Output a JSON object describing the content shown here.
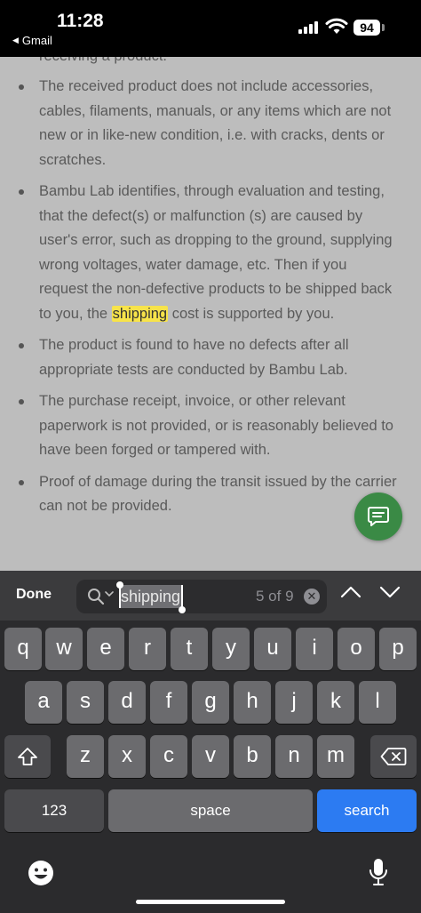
{
  "status_bar": {
    "time": "11:28",
    "back_app": "Gmail",
    "battery": "94"
  },
  "document": {
    "cut_line": "receiving a product.",
    "bullets": [
      {
        "before": "The received product does not include accessories, cables, filaments, manuals, or any items which are not new or in like-new condition, i.e. with cracks, dents or scratches."
      },
      {
        "before": "Bambu Lab identifies, through evaluation and testing, that the defect(s) or malfunction (s) are caused by user's error, such as dropping to the ground, supplying wrong voltages, water damage, etc. Then if you request the non-defective products to be shipped back to you, the ",
        "highlight": "shipping",
        "after": " cost is supported by you."
      },
      {
        "before": "The product is found to have no defects after all appropriate tests are conducted by Bambu Lab."
      },
      {
        "before": "The purchase receipt, invoice, or other relevant paperwork is not provided, or is reasonably believed to have been forged or tampered with."
      },
      {
        "before": "Proof of damage during the transit issued by the carrier can not be provided."
      }
    ],
    "accent_color": "#f7e34a"
  },
  "chat_button": {
    "icon": "chat-icon",
    "color": "#3a8a45"
  },
  "find_bar": {
    "done_label": "Done",
    "query": "shipping",
    "match_count": "5 of 9"
  },
  "keyboard": {
    "row1": [
      "q",
      "w",
      "e",
      "r",
      "t",
      "y",
      "u",
      "i",
      "o",
      "p"
    ],
    "row2": [
      "a",
      "s",
      "d",
      "f",
      "g",
      "h",
      "j",
      "k",
      "l"
    ],
    "row3": [
      "z",
      "x",
      "c",
      "v",
      "b",
      "n",
      "m"
    ],
    "numbers_label": "123",
    "space_label": "space",
    "search_label": "search",
    "search_color": "#2c7bf2"
  }
}
